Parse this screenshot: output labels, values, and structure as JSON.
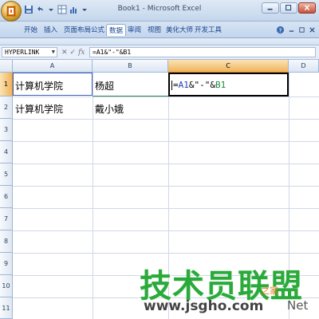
{
  "window": {
    "title": "Book1 - Microsoft Excel"
  },
  "ribbon": {
    "tabs": [
      {
        "label": "开始"
      },
      {
        "label": "插入"
      },
      {
        "label": "页面布局"
      },
      {
        "label": "公式"
      },
      {
        "label": "数据"
      },
      {
        "label": "审阅"
      },
      {
        "label": "视图"
      },
      {
        "label": "美化大师"
      },
      {
        "label": "开发工具"
      }
    ],
    "active_tab_index": 4
  },
  "formula_bar": {
    "name_box": "HYPERLINK",
    "fx_label": "fx",
    "formula": "=A1&\"-\"&B1"
  },
  "sheet": {
    "columns": [
      "A",
      "B",
      "C",
      "D"
    ],
    "rows": [
      "1",
      "2",
      "3",
      "4",
      "5",
      "6",
      "7",
      "8",
      "9",
      "10",
      "11"
    ],
    "cells": {
      "A1": "计算机学院",
      "B1": "杨超",
      "A2": "计算机学院",
      "B2": "戴小娥"
    },
    "active_cell_formula": {
      "part1": "=",
      "ref_a": "A1",
      "part2": "&\"-\"&",
      "ref_b": "B1"
    },
    "active_column": "C",
    "active_row": "1"
  },
  "watermark": {
    "title": "技术员联盟",
    "subtitle": "之家",
    "url": "www.jsgho.com",
    "suffix": "Net"
  },
  "colors": {
    "ref_a": "#1f3fc4",
    "ref_b": "#1c8a3b",
    "watermark_green": "#2aaa3a",
    "selection_orange": "#f1b45a"
  }
}
